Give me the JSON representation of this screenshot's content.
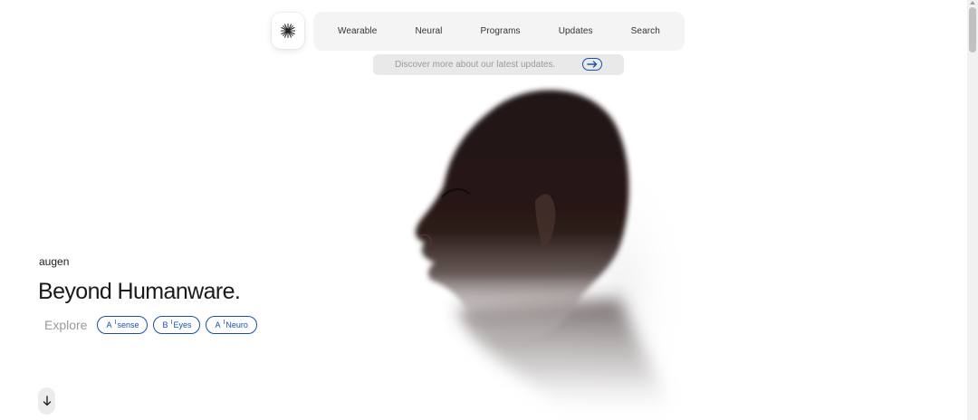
{
  "nav": {
    "items": [
      {
        "label": "Wearable"
      },
      {
        "label": "Neural"
      },
      {
        "label": "Programs"
      },
      {
        "label": "Updates"
      },
      {
        "label": "Search"
      }
    ]
  },
  "updates_bar": {
    "text": "Discover more about our latest updates."
  },
  "hero": {
    "brand": "augen",
    "headline": "Beyond Humanware.",
    "explore_label": "Explore",
    "chips": [
      {
        "letter": "A",
        "tick": "I",
        "name": "sense"
      },
      {
        "letter": "B",
        "tick": "I",
        "name": "Eyes"
      },
      {
        "letter": "A",
        "tick": "I",
        "name": "Neuro"
      }
    ]
  },
  "icons": {
    "logo": "sparkle-asterisk-icon",
    "updates_arrow": "arrow-right-icon",
    "scroll_down": "arrow-down-icon"
  },
  "colors": {
    "accent": "#1d4fa8",
    "background": "#ffffff",
    "nav_background": "#f4f4f4",
    "muted_text": "#9a9a9a"
  }
}
